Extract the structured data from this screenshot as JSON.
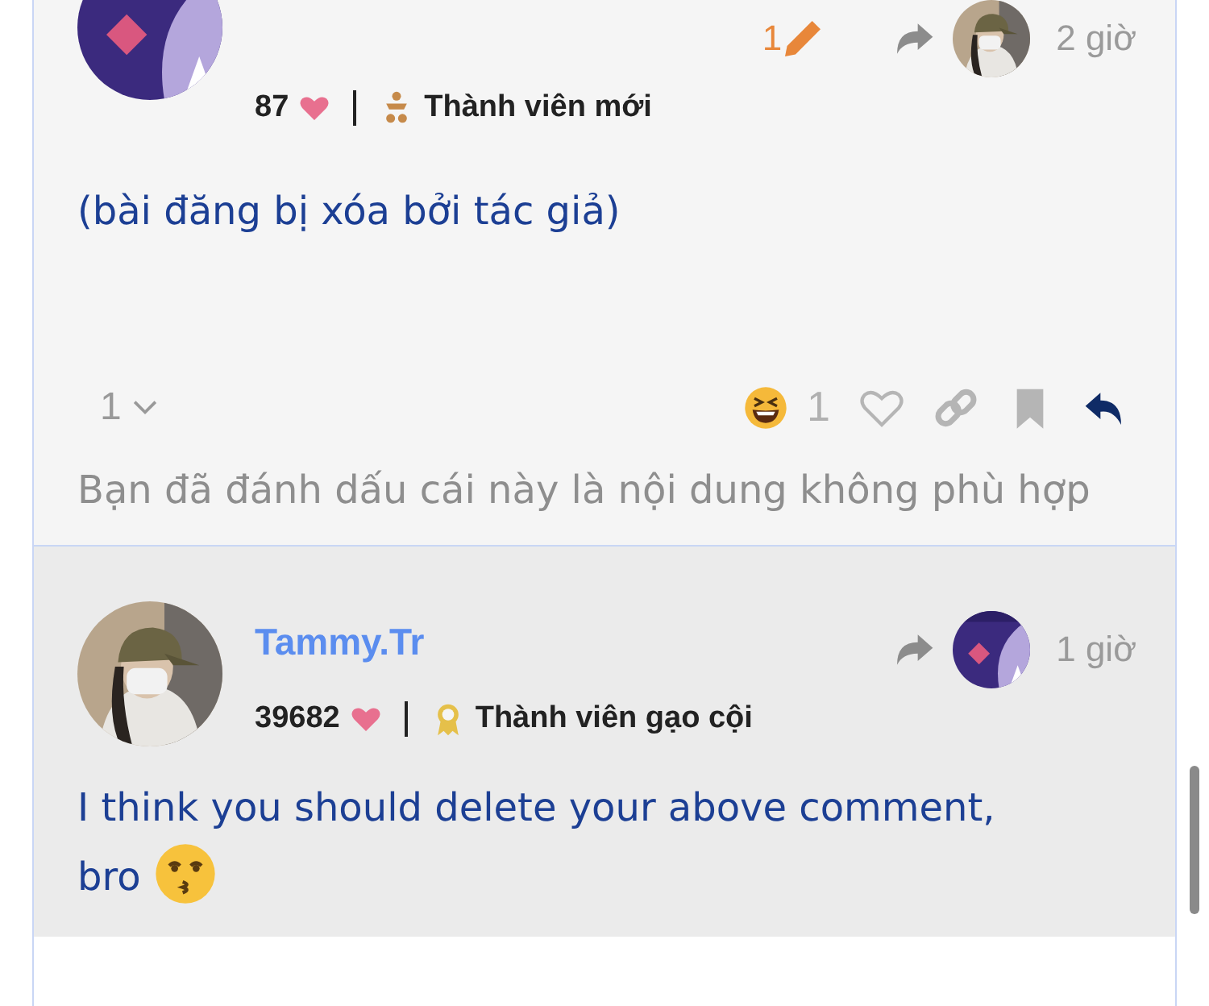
{
  "posts": [
    {
      "cut_top": true,
      "edit_count": "1",
      "time": "2 giờ",
      "likes": "87",
      "badge": {
        "kind": "new",
        "title": "Thành viên mới"
      },
      "body": "(bài đăng bị xóa bởi tác giả)",
      "actions": {
        "replies": "1",
        "reaction_count": "1"
      },
      "flag_notice": "Bạn đã đánh dấu cái này là nội dung không phù hợp"
    },
    {
      "cut_top": false,
      "author": "Tammy.Tr",
      "time": "1 giờ",
      "likes": "39682",
      "badge": {
        "kind": "veteran",
        "title": "Thành viên gạo cội"
      },
      "body": "I think you should delete your above comment, bro",
      "body_icon": {
        "kind": "kiss"
      }
    }
  ]
}
